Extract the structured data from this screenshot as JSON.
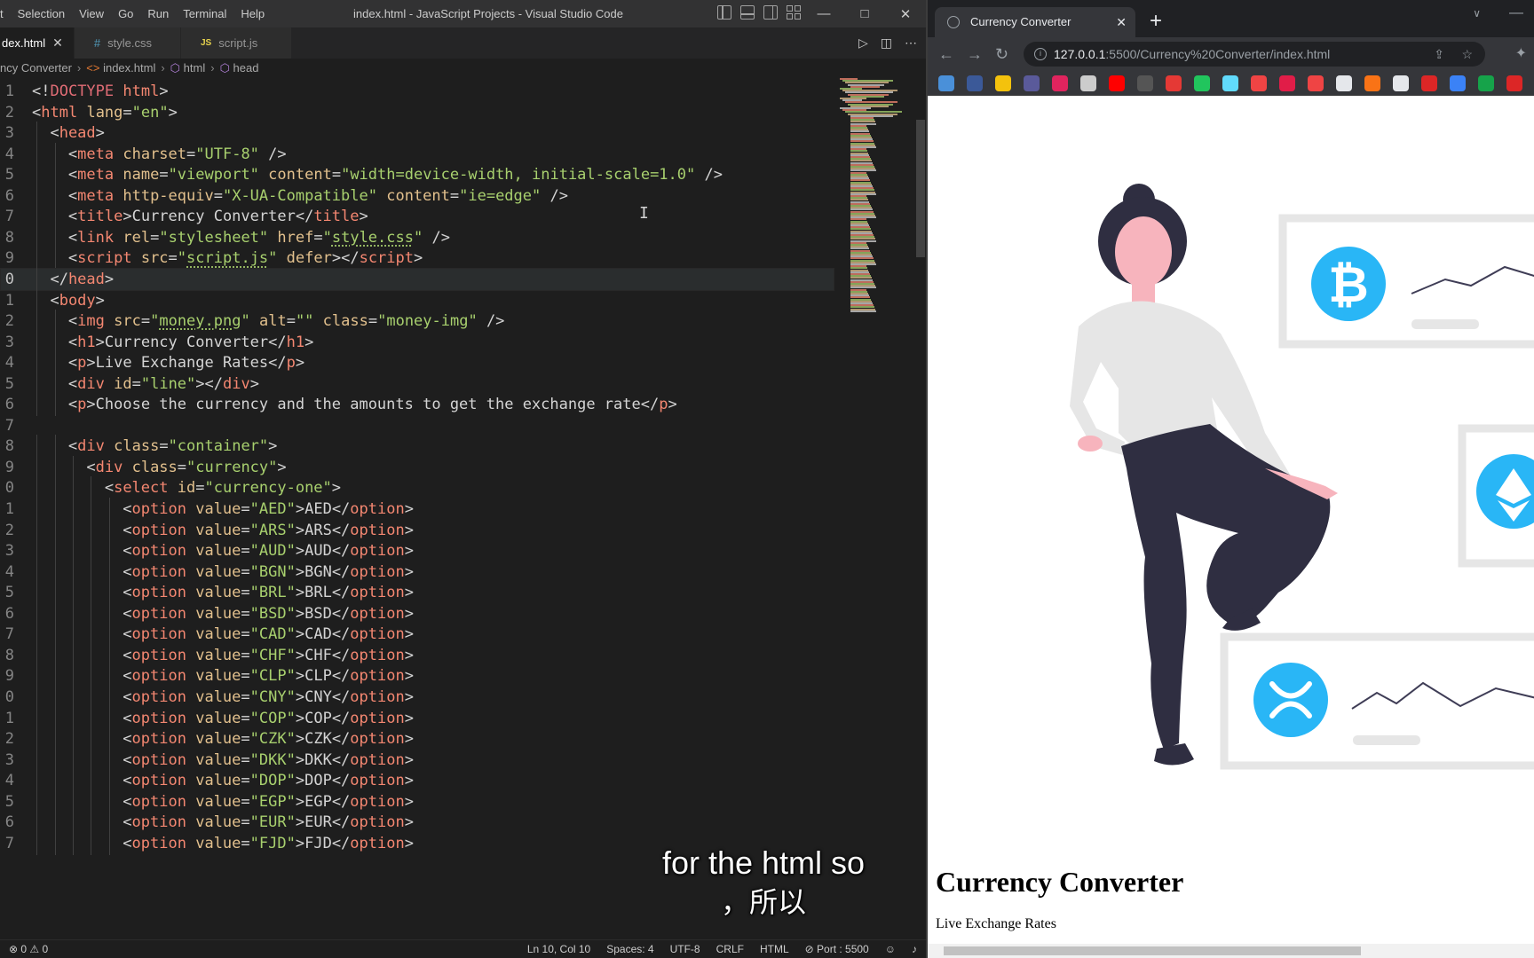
{
  "vscode": {
    "menu": [
      "t",
      "Selection",
      "View",
      "Go",
      "Run",
      "Terminal",
      "Help"
    ],
    "title": "index.html - JavaScript Projects - Visual Studio Code",
    "tabs": [
      {
        "label": "dex.html",
        "active": true
      },
      {
        "label": "style.css",
        "active": false
      },
      {
        "label": "script.js",
        "active": false
      }
    ],
    "breadcrumb": [
      "ncy Converter",
      "index.html",
      "html",
      "head"
    ],
    "code_lines": [
      {
        "num": "1",
        "indent": 0,
        "segments": [
          [
            "punc",
            "<!"
          ],
          [
            "doc",
            "DOCTYPE"
          ],
          [
            "punc",
            " "
          ],
          [
            "tag",
            "html"
          ],
          [
            "punc",
            ">"
          ]
        ]
      },
      {
        "num": "2",
        "indent": 0,
        "segments": [
          [
            "punc",
            "<"
          ],
          [
            "tag",
            "html"
          ],
          [
            "punc",
            " "
          ],
          [
            "attr",
            "lang"
          ],
          [
            "punc",
            "="
          ],
          [
            "str",
            "\"en\""
          ],
          [
            "punc",
            ">"
          ]
        ]
      },
      {
        "num": "3",
        "indent": 1,
        "segments": [
          [
            "punc",
            "<"
          ],
          [
            "tag",
            "head"
          ],
          [
            "punc",
            ">"
          ]
        ]
      },
      {
        "num": "4",
        "indent": 2,
        "segments": [
          [
            "punc",
            "<"
          ],
          [
            "tag",
            "meta"
          ],
          [
            "punc",
            " "
          ],
          [
            "attr",
            "charset"
          ],
          [
            "punc",
            "="
          ],
          [
            "str",
            "\"UTF-8\""
          ],
          [
            "punc",
            " />"
          ]
        ]
      },
      {
        "num": "5",
        "indent": 2,
        "segments": [
          [
            "punc",
            "<"
          ],
          [
            "tag",
            "meta"
          ],
          [
            "punc",
            " "
          ],
          [
            "attr",
            "name"
          ],
          [
            "punc",
            "="
          ],
          [
            "str",
            "\"viewport\""
          ],
          [
            "punc",
            " "
          ],
          [
            "attr",
            "content"
          ],
          [
            "punc",
            "="
          ],
          [
            "str",
            "\"width=device-width, initial-scale=1.0\""
          ],
          [
            "punc",
            " />"
          ]
        ]
      },
      {
        "num": "6",
        "indent": 2,
        "segments": [
          [
            "punc",
            "<"
          ],
          [
            "tag",
            "meta"
          ],
          [
            "punc",
            " "
          ],
          [
            "attr",
            "http-equiv"
          ],
          [
            "punc",
            "="
          ],
          [
            "str",
            "\"X-UA-Compatible\""
          ],
          [
            "punc",
            " "
          ],
          [
            "attr",
            "content"
          ],
          [
            "punc",
            "="
          ],
          [
            "str",
            "\"ie=edge\""
          ],
          [
            "punc",
            " />"
          ]
        ]
      },
      {
        "num": "7",
        "indent": 2,
        "segments": [
          [
            "punc",
            "<"
          ],
          [
            "tag",
            "title"
          ],
          [
            "punc",
            ">"
          ],
          [
            "text",
            "Currency Converter"
          ],
          [
            "punc",
            "</"
          ],
          [
            "tag",
            "title"
          ],
          [
            "punc",
            ">"
          ]
        ]
      },
      {
        "num": "8",
        "indent": 2,
        "segments": [
          [
            "punc",
            "<"
          ],
          [
            "tag",
            "link"
          ],
          [
            "punc",
            " "
          ],
          [
            "attr",
            "rel"
          ],
          [
            "punc",
            "="
          ],
          [
            "str",
            "\"stylesheet\""
          ],
          [
            "punc",
            " "
          ],
          [
            "attr",
            "href"
          ],
          [
            "punc",
            "="
          ],
          [
            "str",
            "\""
          ],
          [
            "link",
            "style.css"
          ],
          [
            "str",
            "\""
          ],
          [
            "punc",
            " />"
          ]
        ]
      },
      {
        "num": "9",
        "indent": 2,
        "segments": [
          [
            "punc",
            "<"
          ],
          [
            "tag",
            "script"
          ],
          [
            "punc",
            " "
          ],
          [
            "attr",
            "src"
          ],
          [
            "punc",
            "="
          ],
          [
            "str",
            "\""
          ],
          [
            "link",
            "script.js"
          ],
          [
            "str",
            "\""
          ],
          [
            "punc",
            " "
          ],
          [
            "attr",
            "defer"
          ],
          [
            "punc",
            "></"
          ],
          [
            "tag",
            "script"
          ],
          [
            "punc",
            ">"
          ]
        ]
      },
      {
        "num": "0",
        "indent": 1,
        "current": true,
        "segments": [
          [
            "punc",
            "</"
          ],
          [
            "tag",
            "head"
          ],
          [
            "punc",
            ">"
          ]
        ]
      },
      {
        "num": "1",
        "indent": 1,
        "segments": [
          [
            "punc",
            "<"
          ],
          [
            "tag",
            "body"
          ],
          [
            "punc",
            ">"
          ]
        ]
      },
      {
        "num": "2",
        "indent": 2,
        "segments": [
          [
            "punc",
            "<"
          ],
          [
            "tag",
            "img"
          ],
          [
            "punc",
            " "
          ],
          [
            "attr",
            "src"
          ],
          [
            "punc",
            "="
          ],
          [
            "str",
            "\""
          ],
          [
            "link",
            "money.png"
          ],
          [
            "str",
            "\""
          ],
          [
            "punc",
            " "
          ],
          [
            "attr",
            "alt"
          ],
          [
            "punc",
            "="
          ],
          [
            "str",
            "\"\""
          ],
          [
            "punc",
            " "
          ],
          [
            "attr",
            "class"
          ],
          [
            "punc",
            "="
          ],
          [
            "str",
            "\"money-img\""
          ],
          [
            "punc",
            " />"
          ]
        ]
      },
      {
        "num": "3",
        "indent": 2,
        "segments": [
          [
            "punc",
            "<"
          ],
          [
            "tag",
            "h1"
          ],
          [
            "punc",
            ">"
          ],
          [
            "text",
            "Currency Converter"
          ],
          [
            "punc",
            "</"
          ],
          [
            "tag",
            "h1"
          ],
          [
            "punc",
            ">"
          ]
        ]
      },
      {
        "num": "4",
        "indent": 2,
        "segments": [
          [
            "punc",
            "<"
          ],
          [
            "tag",
            "p"
          ],
          [
            "punc",
            ">"
          ],
          [
            "text",
            "Live Exchange Rates"
          ],
          [
            "punc",
            "</"
          ],
          [
            "tag",
            "p"
          ],
          [
            "punc",
            ">"
          ]
        ]
      },
      {
        "num": "5",
        "indent": 2,
        "segments": [
          [
            "punc",
            "<"
          ],
          [
            "tag",
            "div"
          ],
          [
            "punc",
            " "
          ],
          [
            "attr",
            "id"
          ],
          [
            "punc",
            "="
          ],
          [
            "str",
            "\"line\""
          ],
          [
            "punc",
            "></"
          ],
          [
            "tag",
            "div"
          ],
          [
            "punc",
            ">"
          ]
        ]
      },
      {
        "num": "6",
        "indent": 2,
        "segments": [
          [
            "punc",
            "<"
          ],
          [
            "tag",
            "p"
          ],
          [
            "punc",
            ">"
          ],
          [
            "text",
            "Choose the currency and the amounts to get the exchange rate"
          ],
          [
            "punc",
            "</"
          ],
          [
            "tag",
            "p"
          ],
          [
            "punc",
            ">"
          ]
        ]
      },
      {
        "num": "7",
        "indent": 0,
        "segments": []
      },
      {
        "num": "8",
        "indent": 2,
        "segments": [
          [
            "punc",
            "<"
          ],
          [
            "tag",
            "div"
          ],
          [
            "punc",
            " "
          ],
          [
            "attr",
            "class"
          ],
          [
            "punc",
            "="
          ],
          [
            "str",
            "\"container\""
          ],
          [
            "punc",
            ">"
          ]
        ]
      },
      {
        "num": "9",
        "indent": 3,
        "segments": [
          [
            "punc",
            "<"
          ],
          [
            "tag",
            "div"
          ],
          [
            "punc",
            " "
          ],
          [
            "attr",
            "class"
          ],
          [
            "punc",
            "="
          ],
          [
            "str",
            "\"currency\""
          ],
          [
            "punc",
            ">"
          ]
        ]
      },
      {
        "num": "0",
        "indent": 4,
        "segments": [
          [
            "punc",
            "<"
          ],
          [
            "tag",
            "select"
          ],
          [
            "punc",
            " "
          ],
          [
            "attr",
            "id"
          ],
          [
            "punc",
            "="
          ],
          [
            "str",
            "\"currency-one\""
          ],
          [
            "punc",
            ">"
          ]
        ]
      },
      {
        "num": "1",
        "indent": 5,
        "option": "AED"
      },
      {
        "num": "2",
        "indent": 5,
        "option": "ARS"
      },
      {
        "num": "3",
        "indent": 5,
        "option": "AUD"
      },
      {
        "num": "4",
        "indent": 5,
        "option": "BGN"
      },
      {
        "num": "5",
        "indent": 5,
        "option": "BRL"
      },
      {
        "num": "6",
        "indent": 5,
        "option": "BSD"
      },
      {
        "num": "7",
        "indent": 5,
        "option": "CAD"
      },
      {
        "num": "8",
        "indent": 5,
        "option": "CHF"
      },
      {
        "num": "9",
        "indent": 5,
        "option": "CLP"
      },
      {
        "num": "0",
        "indent": 5,
        "option": "CNY"
      },
      {
        "num": "1",
        "indent": 5,
        "option": "COP"
      },
      {
        "num": "2",
        "indent": 5,
        "option": "CZK"
      },
      {
        "num": "3",
        "indent": 5,
        "option": "DKK"
      },
      {
        "num": "4",
        "indent": 5,
        "option": "DOP"
      },
      {
        "num": "5",
        "indent": 5,
        "option": "EGP"
      },
      {
        "num": "6",
        "indent": 5,
        "option": "EUR"
      },
      {
        "num": "7",
        "indent": 5,
        "option": "FJD"
      }
    ],
    "status": {
      "errors": "0",
      "warnings": "0",
      "position": "Ln 10, Col 10",
      "spaces": "Spaces: 4",
      "encoding": "UTF-8",
      "eol": "CRLF",
      "language": "HTML",
      "port": "Port : 5500"
    },
    "subtitle_en": "for the html so",
    "subtitle_cn": "，所以"
  },
  "browser": {
    "tab_title": "Currency Converter",
    "url_host": "127.0.0.1",
    "url_path": ":5500/Currency%20Converter/index.html",
    "page_heading": "Currency Converter",
    "page_subheading": "Live Exchange Rates",
    "bookmark_colors": [
      "#4a90d9",
      "#3b5998",
      "#f4c20d",
      "#5a5a9a",
      "#e0245e",
      "#cccccc",
      "#ff0000",
      "#555555",
      "#e53935",
      "#21c55d",
      "#61dafb",
      "#ef4444",
      "#e11d48",
      "#ef4444",
      "#e5e7eb",
      "#f97316",
      "#e5e7eb",
      "#dc2626",
      "#3b82f6",
      "#16a34a",
      "#dc2626"
    ],
    "illustration_colors": {
      "dark": "#2f2e41",
      "skin": "#f7b4bd",
      "shirt": "#e6e6e6",
      "accent": "#29b6f6",
      "card": "#e6e6e6"
    }
  }
}
